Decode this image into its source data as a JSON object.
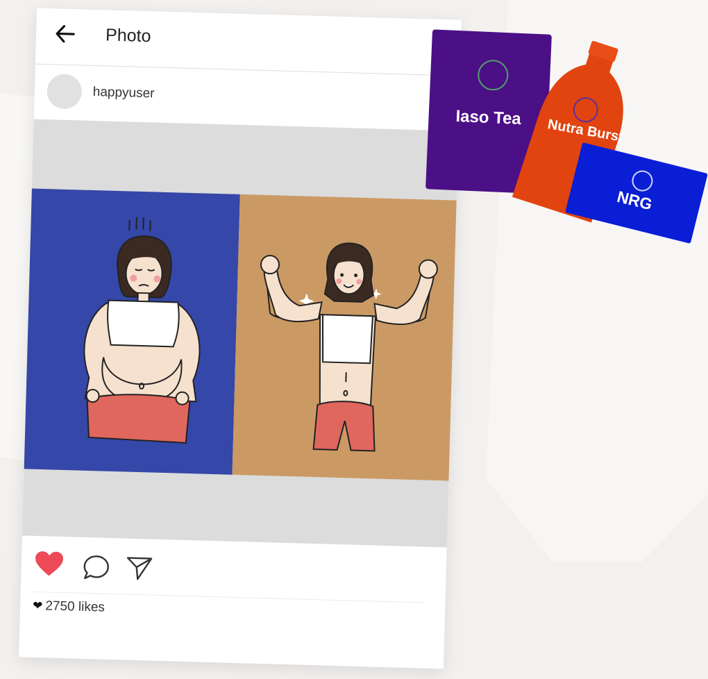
{
  "header": {
    "title": "Photo"
  },
  "post": {
    "username": "happyuser",
    "likes_text": "2750 likes"
  },
  "icons": {
    "back": "back-arrow-icon",
    "like": "heart-icon",
    "comment": "comment-icon",
    "share": "send-icon",
    "likes_heart": "heart-icon"
  },
  "colors": {
    "like_red": "#ec4a57",
    "before_panel": "#3547a8",
    "after_panel": "#cb9a64",
    "iaso_purple": "#4b0f86",
    "nutra_orange": "#e1440f",
    "nrg_blue": "#0a1ed6"
  },
  "products": [
    {
      "name": "Iaso Tea"
    },
    {
      "name": "Nutra Burst"
    },
    {
      "name": "NRG"
    }
  ]
}
